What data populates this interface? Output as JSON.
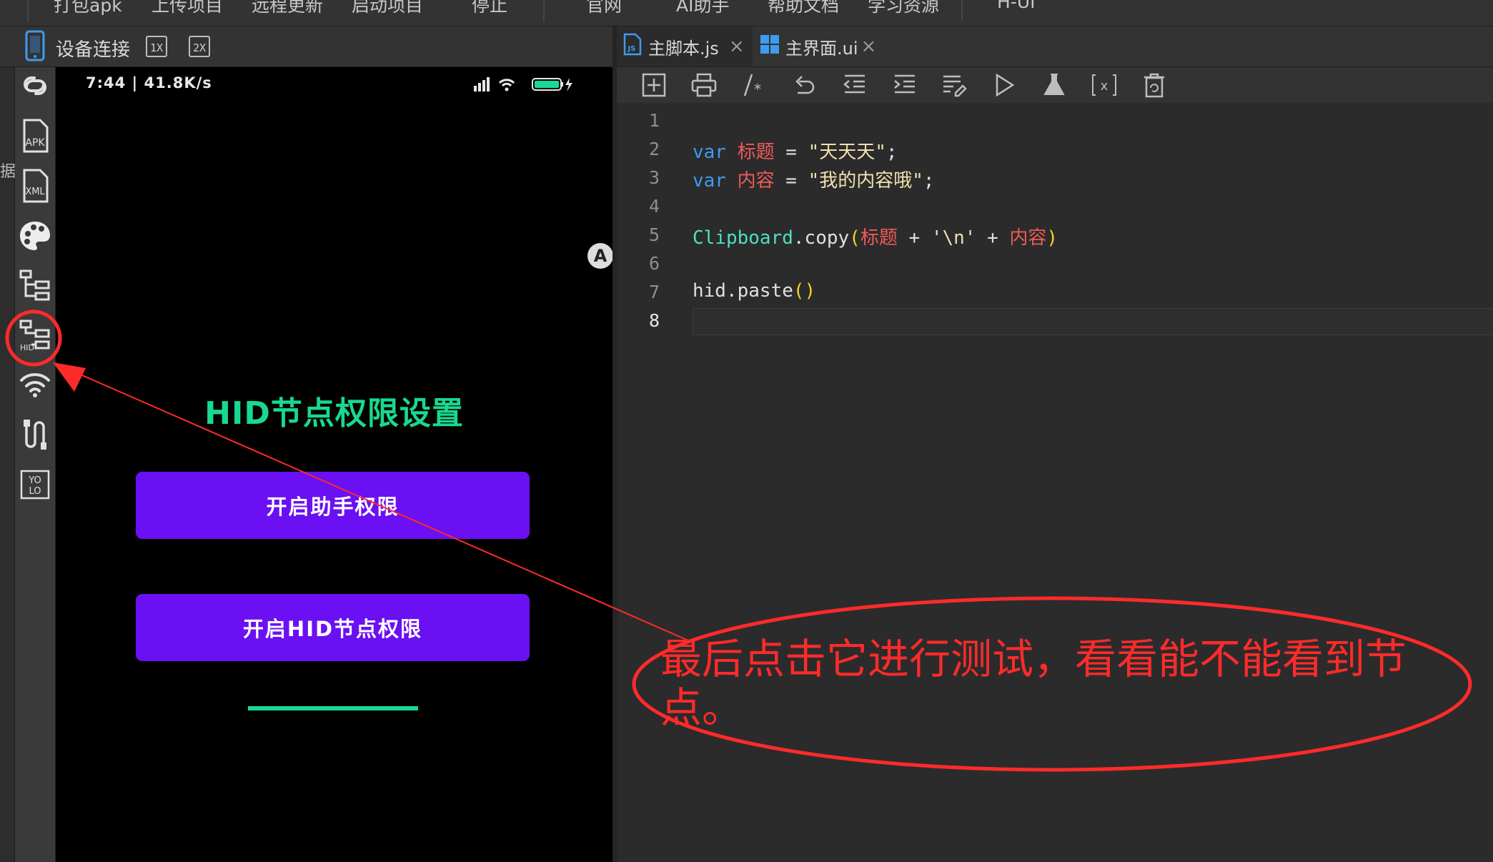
{
  "menu": {
    "items": [
      "打包apk",
      "上传项目",
      "远程更新",
      "启动项目",
      "停止",
      "官网",
      "AI助手",
      "帮助文档",
      "学习资源",
      "H-UI"
    ]
  },
  "device": {
    "label": "设备连接",
    "scale_1x": "1X",
    "scale_2x": "2X"
  },
  "left_edge_text": "据",
  "tools": [
    "link-icon",
    "apk-icon",
    "xml-icon",
    "palette-icon",
    "node-tree-icon",
    "hid-node-tree-icon",
    "wifi-icon",
    "usb-cable-icon",
    "yolo-icon"
  ],
  "tool_labels": {
    "apk": "APK",
    "xml": "XML",
    "hid": "HID",
    "yolo_top": "YO",
    "yolo_bottom": "LO"
  },
  "phone": {
    "status": "7:44 | 41.8K/s",
    "title": "HID节点权限设置",
    "button1": "开启助手权限",
    "button2": "开启HID节点权限"
  },
  "tabs": [
    {
      "label": "主脚本.js",
      "icon": "js-file-icon",
      "icon_text": "JS"
    },
    {
      "label": "主界面.ui",
      "icon": "ui-file-icon"
    }
  ],
  "toolbar_icons": [
    "add-icon",
    "print-icon",
    "comment-icon",
    "undo-icon",
    "outdent-icon",
    "indent-icon",
    "format-icon",
    "run-icon",
    "test-icon",
    "variable-icon",
    "clear-icon"
  ],
  "code": {
    "line_numbers": [
      "1",
      "2",
      "3",
      "4",
      "5",
      "6",
      "7",
      "8"
    ],
    "line2": {
      "kw": "var",
      "name": "标题",
      "eq": " = ",
      "str": "\"天天天\"",
      "end": ";"
    },
    "line3": {
      "kw": "var",
      "name": "内容",
      "eq": " = ",
      "str": "\"我的内容哦\"",
      "end": ";"
    },
    "line5": {
      "cls": "Clipboard",
      "method": ".copy",
      "open": "(",
      "a": "标题",
      "plus1": " + ",
      "s": "'\\n'",
      "plus2": " + ",
      "b": "内容",
      "close": ")"
    },
    "line7": {
      "fn": "hid.paste",
      "parens": "()"
    }
  },
  "annotation": {
    "text": "最后点击它进行测试，看看能不能看到节点。",
    "color": "#ff2a2a"
  },
  "colors": {
    "keyword": "#3d9cf0",
    "variable": "#f05a5a",
    "string": "#f0e0b0",
    "class": "#4ee0c0",
    "paren": "#f2d32a",
    "phone_title": "#18d98f",
    "phone_button": "#6a10f3"
  }
}
